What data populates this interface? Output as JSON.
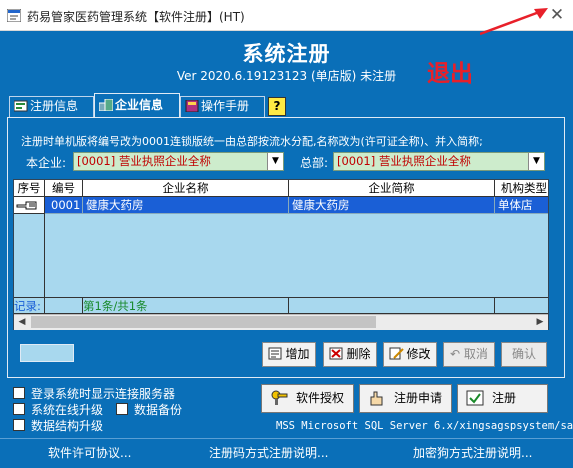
{
  "window": {
    "title": "药易管家医药管理系统【软件注册】(HT)",
    "close_glyph": "✕"
  },
  "header": {
    "heading": "系统注册",
    "version": "Ver 2020.6.19123123 (单店版) 未注册",
    "exit_annotation": "退出",
    "annotation_color": "#e8202a"
  },
  "tabs": [
    {
      "label": "注册信息",
      "icon": "info-icon"
    },
    {
      "label": "企业信息",
      "icon": "company-icon"
    },
    {
      "label": "操作手册",
      "icon": "book-icon"
    },
    {
      "label": "?",
      "icon": "help-icon"
    }
  ],
  "panel": {
    "note": "注册时单机版将编号改为0001连锁版统一由总部按流水分配,名称改为(许可证全称)、并入简称;",
    "company_label": "本企业:",
    "company_value": "[0001] 营业执照企业全称",
    "hq_label": "总部:",
    "hq_value": "[0001] 营业执照企业全称"
  },
  "grid": {
    "columns": [
      "序号",
      "编号",
      "企业名称",
      "企业简称",
      "机构类型"
    ],
    "rows": [
      {
        "no": "",
        "code": "0001",
        "name": "健康大药房",
        "short": "健康大药房",
        "type": "单体店"
      }
    ],
    "footer_label": "记录:",
    "footer_count": "第1条/共1条"
  },
  "actions": {
    "add": "增加",
    "delete": "删除",
    "edit": "修改",
    "cancel": "取消",
    "confirm": "确认"
  },
  "options": {
    "show_server": "登录系统时显示连接服务器",
    "online_upgrade": "系统在线升级",
    "data_backup": "数据备份",
    "structure_upgrade": "数据结构升级"
  },
  "register": {
    "license": "软件授权",
    "apply": "注册申请",
    "register": "注册"
  },
  "server_info": "MSS Microsoft SQL Server 6.x/xingsagspsystem/sa",
  "footer_links": {
    "agreement": "软件许可协议...",
    "code_help": "注册码方式注册说明...",
    "dongle_help": "加密狗方式注册说明..."
  },
  "colors": {
    "background": "#0a6fb8",
    "grid_background": "#a8d8ee",
    "selected_row": "#1a5fd6",
    "combo_background": "#cdeccc",
    "combo_text": "#c00000"
  }
}
